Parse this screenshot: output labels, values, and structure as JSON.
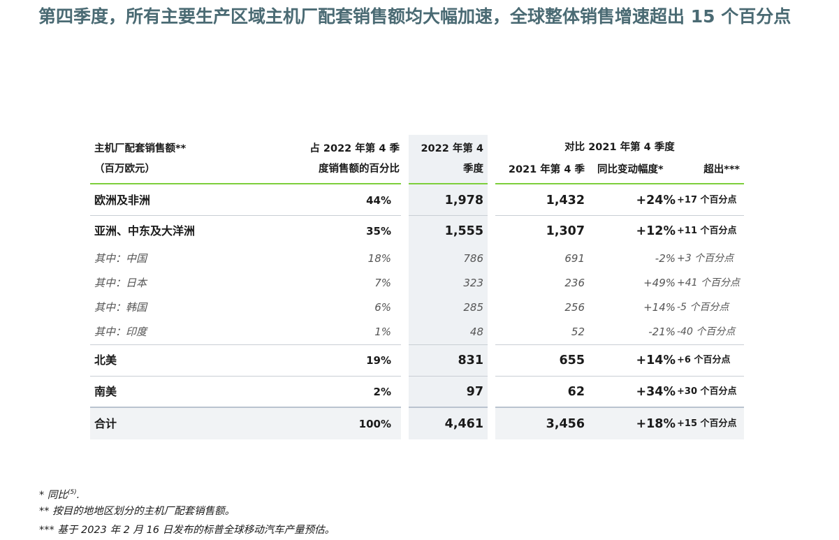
{
  "heading": "第四季度，所有主要生产区域主机厂配套销售额均大幅加速，全球整体销售增速超出 15 个百分点",
  "table": {
    "headers": {
      "region_line1": "主机厂配套销售额**",
      "region_line2": "（百万欧元）",
      "share_line1": "占 2022 年第 4 季",
      "share_line2": "度销售额的百分比",
      "q4_line1": "2022 年第 4",
      "q4_line2": "季度",
      "compare": "对比 2021 年第 4 季度",
      "q4_2021": "2021 年第 4 季",
      "yoy": "同比变动幅度*",
      "outperformance": "超出***"
    },
    "rows": [
      {
        "name": "欧洲及非洲",
        "share": "44%",
        "q4_2022": "1,978",
        "q4_2021": "1,432",
        "yoy": "+24%",
        "outperf": "+17 个百分点"
      },
      {
        "name": "亚洲、中东及大洋洲",
        "share": "35%",
        "q4_2022": "1,555",
        "q4_2021": "1,307",
        "yoy": "+12%",
        "outperf": "+11 个百分点"
      },
      {
        "name": "其中：中国",
        "share": "18%",
        "q4_2022": "786",
        "q4_2021": "691",
        "yoy": "-2%",
        "outperf": "+3 个百分点"
      },
      {
        "name": "其中：日本",
        "share": "7%",
        "q4_2022": "323",
        "q4_2021": "236",
        "yoy": "+49%",
        "outperf": "+41 个百分点"
      },
      {
        "name": "其中：韩国",
        "share": "6%",
        "q4_2022": "285",
        "q4_2021": "256",
        "yoy": "+14%",
        "outperf": "-5 个百分点"
      },
      {
        "name": "其中：印度",
        "share": "1%",
        "q4_2022": "48",
        "q4_2021": "52",
        "yoy": "-21%",
        "outperf": "-40 个百分点"
      },
      {
        "name": "北美",
        "share": "19%",
        "q4_2022": "831",
        "q4_2021": "655",
        "yoy": "+14%",
        "outperf": "+6 个百分点"
      },
      {
        "name": "南美",
        "share": "2%",
        "q4_2022": "97",
        "q4_2021": "62",
        "yoy": "+34%",
        "outperf": "+30 个百分点"
      },
      {
        "name": "合计",
        "share": "100%",
        "q4_2022": "4,461",
        "q4_2021": "3,456",
        "yoy": "+18%",
        "outperf": "+15 个百分点"
      }
    ]
  },
  "footnotes": {
    "note1_text": "* 同比",
    "note1_sup": "(5)",
    "note1_end": ".",
    "note2": "** 按目的地地区划分的主机厂配套销售额。",
    "note3": "*** 基于 2023 年 2 月 16 日发布的标普全球移动汽车产量预估。"
  }
}
